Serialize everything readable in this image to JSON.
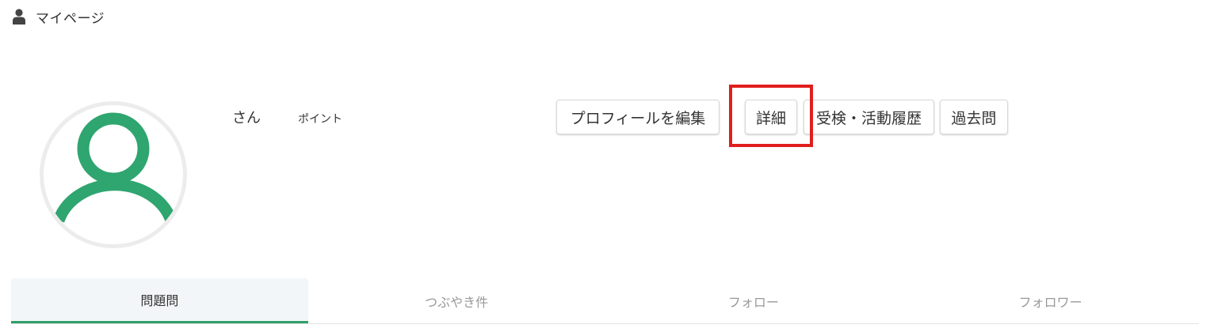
{
  "header": {
    "title": "マイページ",
    "icon": "user-icon"
  },
  "profile": {
    "avatar_icon": "user-avatar-icon",
    "avatar_color": "#2fa56f",
    "name_label": "さん",
    "points_label": "ポイント"
  },
  "actions": {
    "edit_profile": "プロフィールを編集",
    "detail": "詳細",
    "history": "受検・活動履歴",
    "past_questions": "過去問"
  },
  "highlight": {
    "color": "#e01e1e",
    "target": "detail"
  },
  "tabs": [
    {
      "label": "問題問",
      "active": true
    },
    {
      "label": "つぶやき件",
      "active": false
    },
    {
      "label": "フォロー",
      "active": false
    },
    {
      "label": "フォロワー",
      "active": false
    }
  ],
  "colors": {
    "accent": "#2f9e6a",
    "highlight": "#e01e1e"
  }
}
